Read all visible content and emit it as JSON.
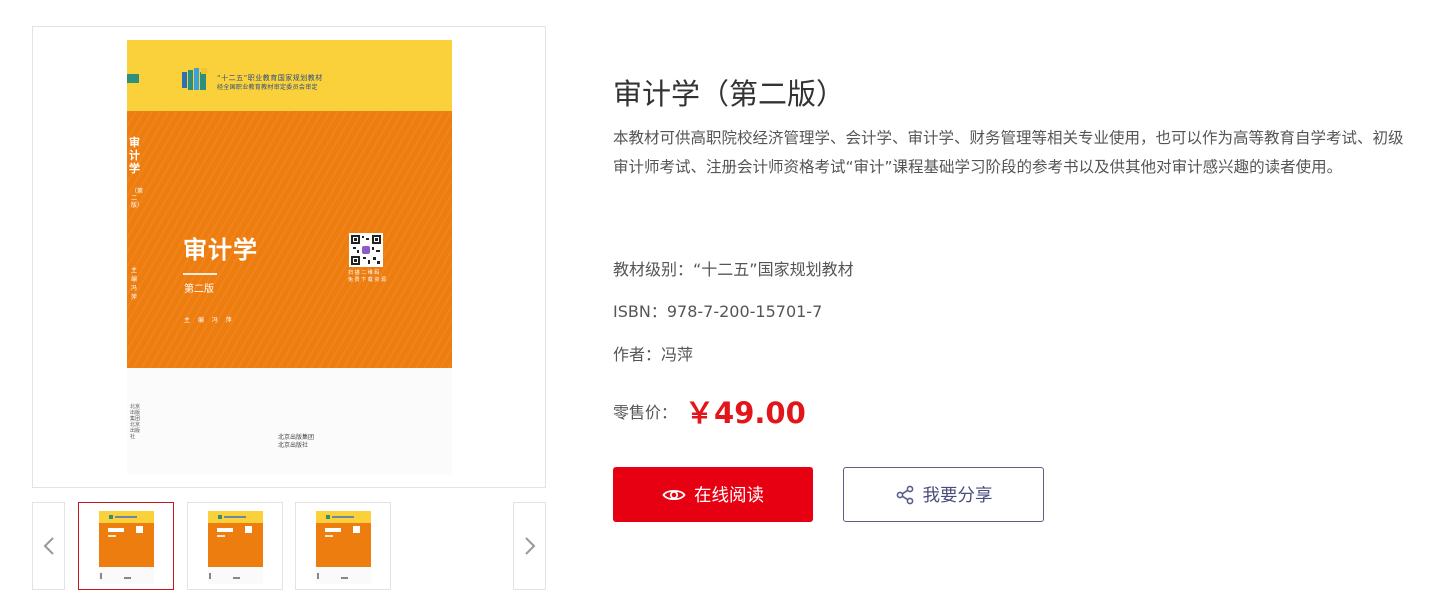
{
  "preview": {
    "cover": {
      "series_line1": "“十二五”职业教育国家规划教材",
      "series_line2": "经全国职业教育教材审定委员会审定",
      "spine_title": "审计学",
      "spine_edition": "（第二版）",
      "spine_author": "主编冯萍",
      "title": "审计学",
      "edition": "第二版",
      "editor": "主 编 冯 萍",
      "qr_caption1": "扫 描 二 维 码",
      "qr_caption2": "免 费 下 载 资 源",
      "imprint_spine": "北京出版集团北京出版社",
      "imprint_line1": "北京出版集团",
      "imprint_line2": "北京出版社",
      "colors": {
        "top": "#fbd13b",
        "middle": "#ee7d10"
      }
    },
    "thumbnails": [
      {
        "active": true
      },
      {
        "active": false
      },
      {
        "active": false
      }
    ],
    "prev_icon": "chevron-left-icon",
    "next_icon": "chevron-right-icon"
  },
  "book": {
    "title": "审计学（第二版）",
    "description": "本教材可供高职院校经济管理学、会计学、审计学、财务管理等相关专业使用，也可以作为高等教育自学考试、初级审计师考试、注册会计师资格考试“审计”课程基础学习阶段的参考书以及供其他对审计感兴趣的读者使用。",
    "level_label": "教材级别：",
    "level_value": "“十二五”国家规划教材",
    "isbn_label": "ISBN：",
    "isbn_value": "978-7-200-15701-7",
    "author_label": "作者：",
    "author_value": "冯萍",
    "price_label": "零售价：",
    "price_value": "￥49.00"
  },
  "actions": {
    "read_label": "在线阅读",
    "read_icon": "eye-icon",
    "share_label": "我要分享",
    "share_icon": "share-icon"
  },
  "colors": {
    "accent": "#e60012",
    "price": "#e2151b",
    "share_border": "#5c5e8a",
    "active_thumb_border": "#c8161d"
  }
}
